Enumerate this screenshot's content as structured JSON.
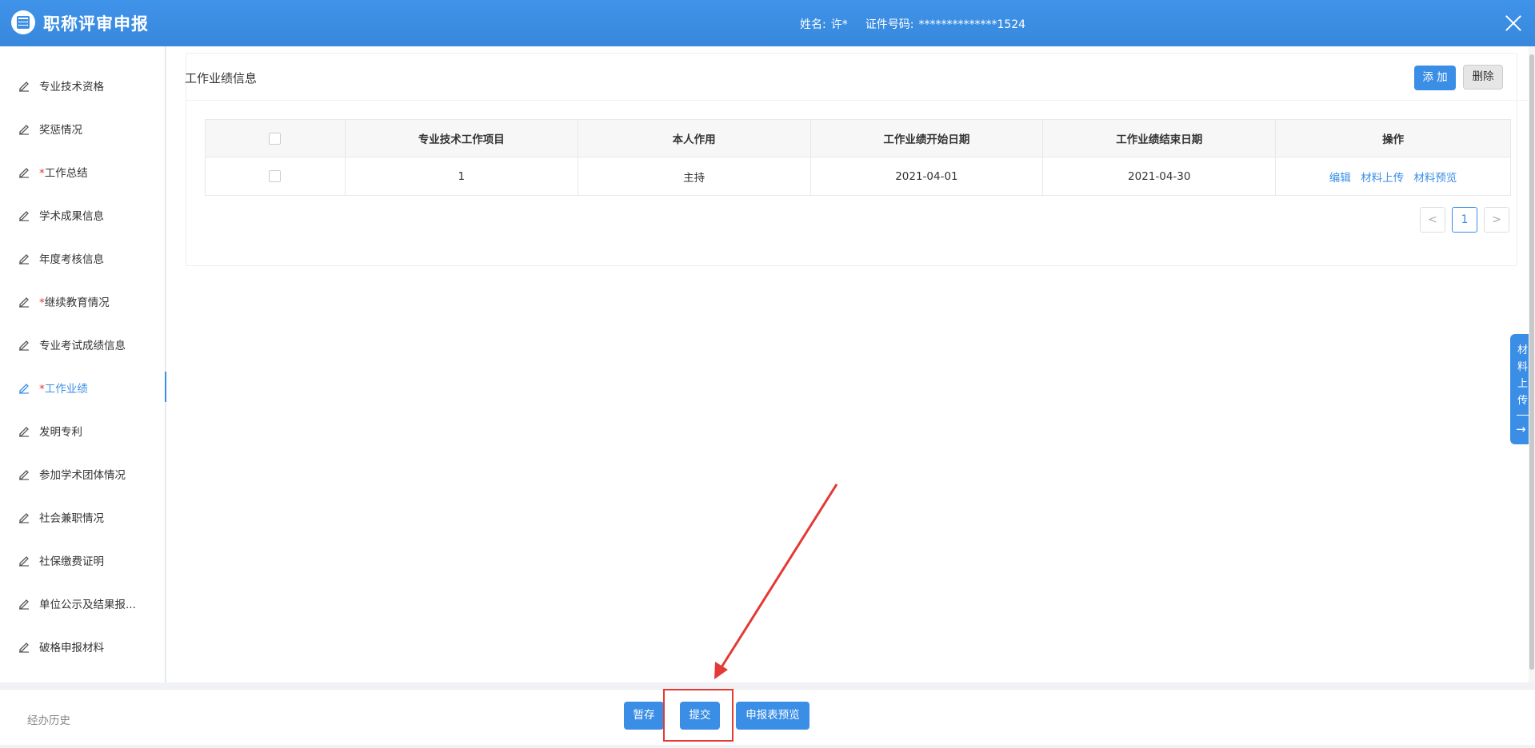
{
  "header": {
    "title": "职称评审申报",
    "name_label": "姓名:",
    "name_value": "许*",
    "id_label": "证件号码:",
    "id_value": "**************1524",
    "close_icon": "close-icon",
    "logo_icon": "list-document-icon"
  },
  "sidebar": {
    "items": [
      {
        "label": "专业技术资格",
        "required": false
      },
      {
        "label": "奖惩情况",
        "required": false
      },
      {
        "label": "工作总结",
        "required": true
      },
      {
        "label": "学术成果信息",
        "required": false
      },
      {
        "label": "年度考核信息",
        "required": false
      },
      {
        "label": "继续教育情况",
        "required": true
      },
      {
        "label": "专业考试成绩信息",
        "required": false
      },
      {
        "label": "工作业绩",
        "required": true,
        "active": true
      },
      {
        "label": "发明专利",
        "required": false
      },
      {
        "label": "参加学术团体情况",
        "required": false
      },
      {
        "label": "社会兼职情况",
        "required": false
      },
      {
        "label": "社保缴费证明",
        "required": false
      },
      {
        "label": "单位公示及结果报...",
        "required": false
      },
      {
        "label": "破格申报材料",
        "required": false
      }
    ],
    "star": "*",
    "item_icon": "edit-pen-icon"
  },
  "panel": {
    "title": "工作业绩信息",
    "add_label": "添 加",
    "delete_label": "删除",
    "table": {
      "headers": [
        "专业技术工作项目",
        "本人作用",
        "工作业绩开始日期",
        "工作业绩结束日期",
        "操作"
      ],
      "rows": [
        {
          "project": "1",
          "role": "主持",
          "start": "2021-04-01",
          "end": "2021-04-30"
        }
      ],
      "actions": [
        "编辑",
        "材料上传",
        "材料预览"
      ]
    },
    "pager": {
      "prev": "<",
      "current": "1",
      "next": ">"
    }
  },
  "float_tab": {
    "chars": [
      "材",
      "料",
      "上",
      "传"
    ],
    "arrow": "→"
  },
  "footer": {
    "history_label": "经办历史",
    "save_draft_label": "暂存",
    "submit_label": "提交",
    "preview_label": "申报表预览"
  },
  "colors": {
    "primary": "#3a8ee6",
    "required_star": "#e0312f",
    "annotation": "#e53935"
  }
}
